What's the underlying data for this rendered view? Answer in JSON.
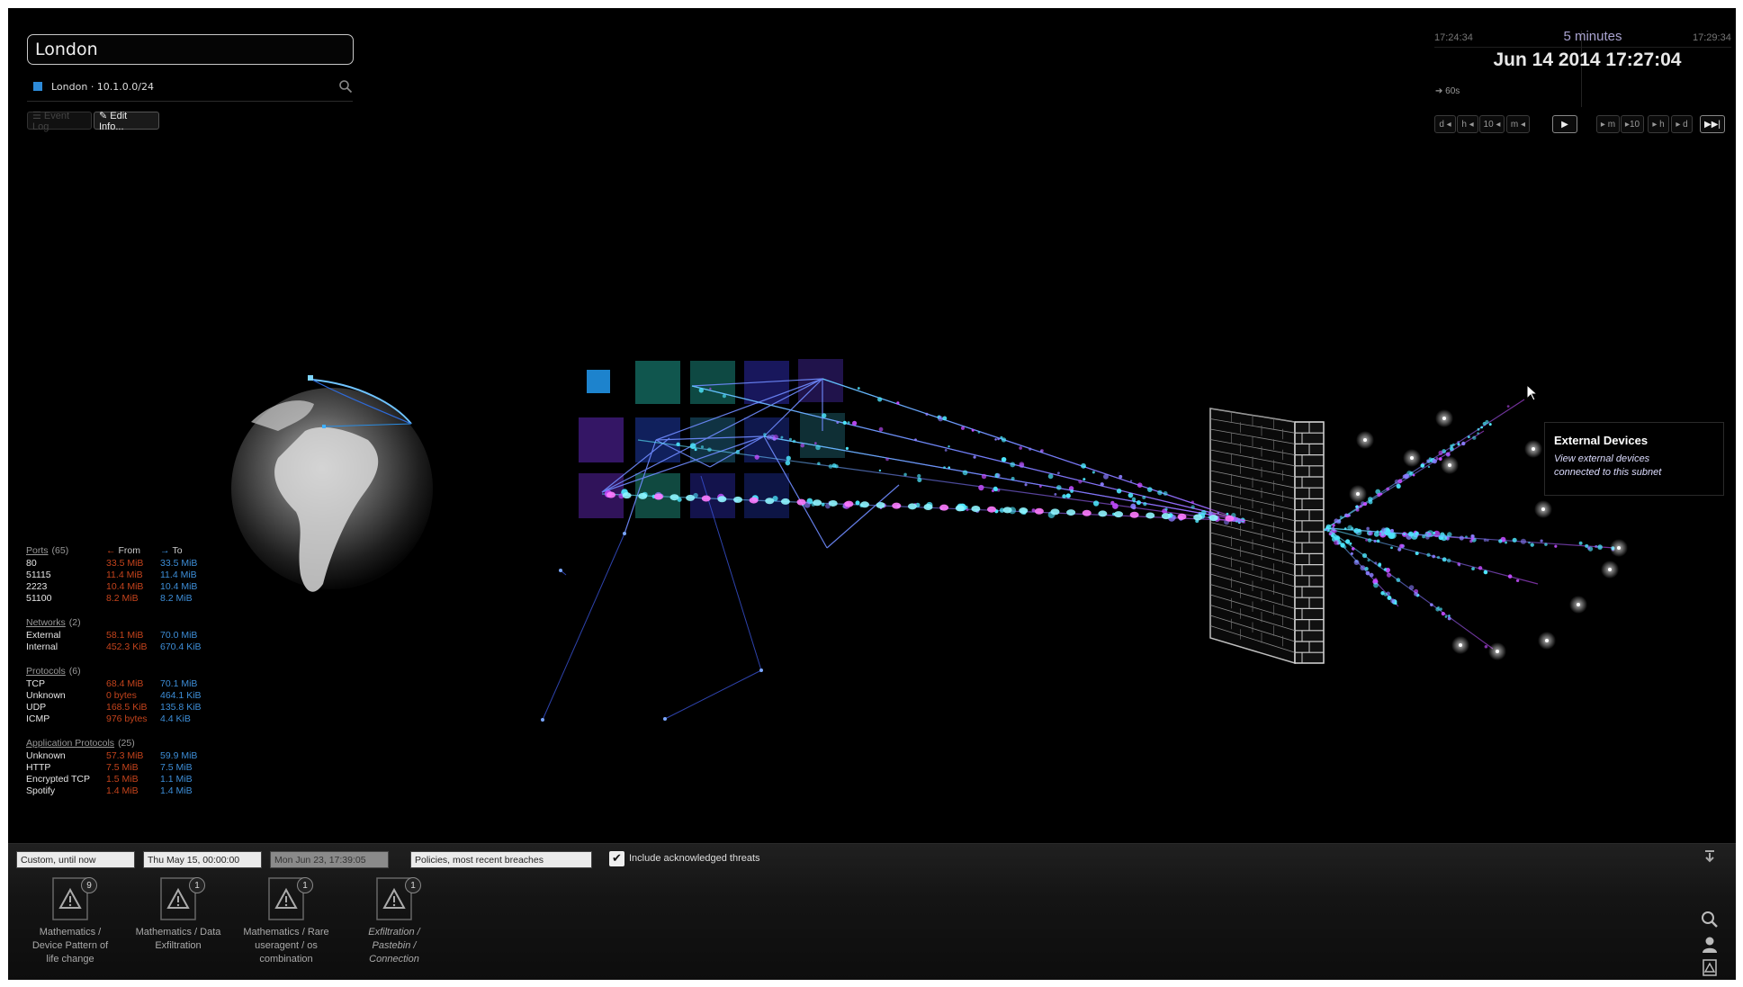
{
  "search": {
    "value": "London"
  },
  "result": {
    "label": "London · 10.1.0.0/24",
    "swatch_color": "#2d8ad8"
  },
  "buttons": {
    "event_log": "☰ Event Log",
    "edit_info": "✎ Edit Info..."
  },
  "time": {
    "start": "17:24:34",
    "end": "17:29:34",
    "range": "5 minutes",
    "current": "Jun 14 2014 17:27:04",
    "scale": "➔ 60s",
    "controls": [
      "d ◂",
      "h ◂",
      "10 ◂",
      "m ◂",
      "▶",
      "▸ m",
      "▸10",
      "▸ h",
      "▸ d",
      "▶▶|"
    ]
  },
  "stats": {
    "cols": {
      "from": "From",
      "to": "To",
      "from_arrow": "←",
      "to_arrow": "→"
    },
    "groups": [
      {
        "title": "Ports",
        "count": "(65)",
        "show_cols": true,
        "rows": [
          {
            "label": "80",
            "from": "33.5 MiB",
            "to": "33.5 MiB"
          },
          {
            "label": "51115",
            "from": "11.4 MiB",
            "to": "11.4 MiB"
          },
          {
            "label": "2223",
            "from": "10.4 MiB",
            "to": "10.4 MiB"
          },
          {
            "label": "51100",
            "from": "8.2 MiB",
            "to": "8.2 MiB"
          }
        ]
      },
      {
        "title": "Networks",
        "count": "(2)",
        "show_cols": false,
        "rows": [
          {
            "label": "External",
            "from": "58.1 MiB",
            "to": "70.0 MiB"
          },
          {
            "label": "Internal",
            "from": "452.3 KiB",
            "to": "670.4 KiB"
          }
        ]
      },
      {
        "title": "Protocols",
        "count": "(6)",
        "show_cols": false,
        "rows": [
          {
            "label": "TCP",
            "from": "68.4 MiB",
            "to": "70.1 MiB"
          },
          {
            "label": "Unknown",
            "from": "0 bytes",
            "to": "464.1 KiB"
          },
          {
            "label": "UDP",
            "from": "168.5 KiB",
            "to": "135.8 KiB"
          },
          {
            "label": "ICMP",
            "from": "976 bytes",
            "to": "4.4 KiB"
          }
        ]
      },
      {
        "title": "Application Protocols",
        "count": "(25)",
        "show_cols": false,
        "rows": [
          {
            "label": "Unknown",
            "from": "57.3 MiB",
            "to": "59.9 MiB"
          },
          {
            "label": "HTTP",
            "from": "7.5 MiB",
            "to": "7.5 MiB"
          },
          {
            "label": "Encrypted TCP",
            "from": "1.5 MiB",
            "to": "1.1 MiB"
          },
          {
            "label": "Spotify",
            "from": "1.4 MiB",
            "to": "1.4 MiB"
          }
        ]
      }
    ]
  },
  "tooltip": {
    "title": "External Devices",
    "body_line1": "View external devices",
    "body_line2": "connected to this subnet"
  },
  "bottom": {
    "filters": [
      "Custom, until now",
      "Thu May 15, 00:00:00",
      "Mon Jun 23, 17:39:05",
      "Policies, most recent breaches"
    ],
    "include_label": "Include acknowledged threats",
    "include_checked": true,
    "threats": [
      {
        "badge": "9",
        "lines": [
          "Mathematics /",
          "Device Pattern of",
          "life change"
        ],
        "italic": false
      },
      {
        "badge": "1",
        "lines": [
          "Mathematics / Data",
          "Exfiltration"
        ],
        "italic": false
      },
      {
        "badge": "1",
        "lines": [
          "Mathematics / Rare",
          "useragent / os",
          "combination"
        ],
        "italic": false
      },
      {
        "badge": "1",
        "lines": [
          "Exfiltration /",
          "Pastebin /",
          "Connection"
        ],
        "italic": true
      }
    ]
  },
  "colors": {
    "accent_blue": "#3d8ed8",
    "accent_orange": "#c4431c",
    "particle_cyan": "#4ee8ff",
    "particle_magenta": "#c34cff"
  }
}
